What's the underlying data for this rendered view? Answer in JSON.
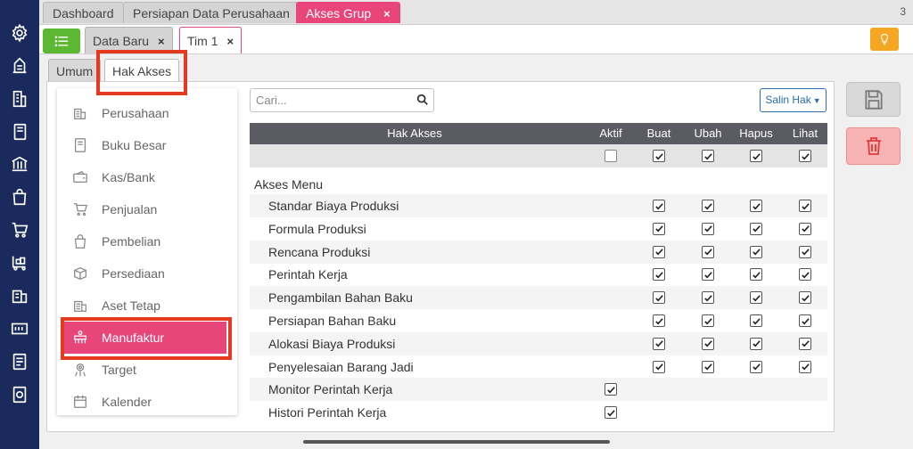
{
  "top_tabs": [
    {
      "label": "Dashboard"
    },
    {
      "label": "Persiapan Data Perusahaan"
    },
    {
      "label": "Akses Grup",
      "close": "×"
    }
  ],
  "tab_count": "3",
  "sub_tabs": [
    {
      "label": "Data Baru",
      "close": "×"
    },
    {
      "label": "Tim 1",
      "close": "×"
    }
  ],
  "inner_tabs": [
    {
      "label": "Umum"
    },
    {
      "label": "Hak Akses"
    }
  ],
  "categories": [
    {
      "label": "Perusahaan",
      "icon": "building-icon"
    },
    {
      "label": "Buku Besar",
      "icon": "ledger-icon"
    },
    {
      "label": "Kas/Bank",
      "icon": "wallet-icon"
    },
    {
      "label": "Penjualan",
      "icon": "cart-icon"
    },
    {
      "label": "Pembelian",
      "icon": "shopping-bag-icon"
    },
    {
      "label": "Persediaan",
      "icon": "box-icon"
    },
    {
      "label": "Aset Tetap",
      "icon": "asset-icon"
    },
    {
      "label": "Manufaktur",
      "icon": "manufacture-icon",
      "active": true
    },
    {
      "label": "Target",
      "icon": "target-icon"
    },
    {
      "label": "Kalender",
      "icon": "calendar-icon"
    }
  ],
  "search": {
    "placeholder": "Cari..."
  },
  "salin_button": "Salin Hak",
  "table": {
    "columns": [
      "Hak Akses",
      "Aktif",
      "Buat",
      "Ubah",
      "Hapus",
      "Lihat"
    ],
    "header_checks": {
      "aktif": false,
      "buat": true,
      "ubah": true,
      "hapus": true,
      "lihat": true
    },
    "section_label": "Akses Menu",
    "rows": [
      {
        "label": "Standar Biaya Produksi",
        "aktif": null,
        "buat": true,
        "ubah": true,
        "hapus": true,
        "lihat": true
      },
      {
        "label": "Formula Produksi",
        "aktif": null,
        "buat": true,
        "ubah": true,
        "hapus": true,
        "lihat": true
      },
      {
        "label": "Rencana Produksi",
        "aktif": null,
        "buat": true,
        "ubah": true,
        "hapus": true,
        "lihat": true
      },
      {
        "label": "Perintah Kerja",
        "aktif": null,
        "buat": true,
        "ubah": true,
        "hapus": true,
        "lihat": true
      },
      {
        "label": "Pengambilan Bahan Baku",
        "aktif": null,
        "buat": true,
        "ubah": true,
        "hapus": true,
        "lihat": true
      },
      {
        "label": "Persiapan Bahan Baku",
        "aktif": null,
        "buat": true,
        "ubah": true,
        "hapus": true,
        "lihat": true
      },
      {
        "label": "Alokasi Biaya Produksi",
        "aktif": null,
        "buat": true,
        "ubah": true,
        "hapus": true,
        "lihat": true
      },
      {
        "label": "Penyelesaian Barang Jadi",
        "aktif": null,
        "buat": true,
        "ubah": true,
        "hapus": true,
        "lihat": true
      },
      {
        "label": "Monitor Perintah Kerja",
        "aktif": true,
        "buat": null,
        "ubah": null,
        "hapus": null,
        "lihat": null
      },
      {
        "label": "Histori Perintah Kerja",
        "aktif": true,
        "buat": null,
        "ubah": null,
        "hapus": null,
        "lihat": null
      }
    ]
  },
  "colors": {
    "sidebar": "#1b2a5c",
    "accent": "#e8457a",
    "highlight_frame": "#e53a1f",
    "list_button": "#5cb832",
    "bulb_button": "#f5a623",
    "delete_button": "#f8b4b4",
    "table_header": "#5b5b63"
  }
}
